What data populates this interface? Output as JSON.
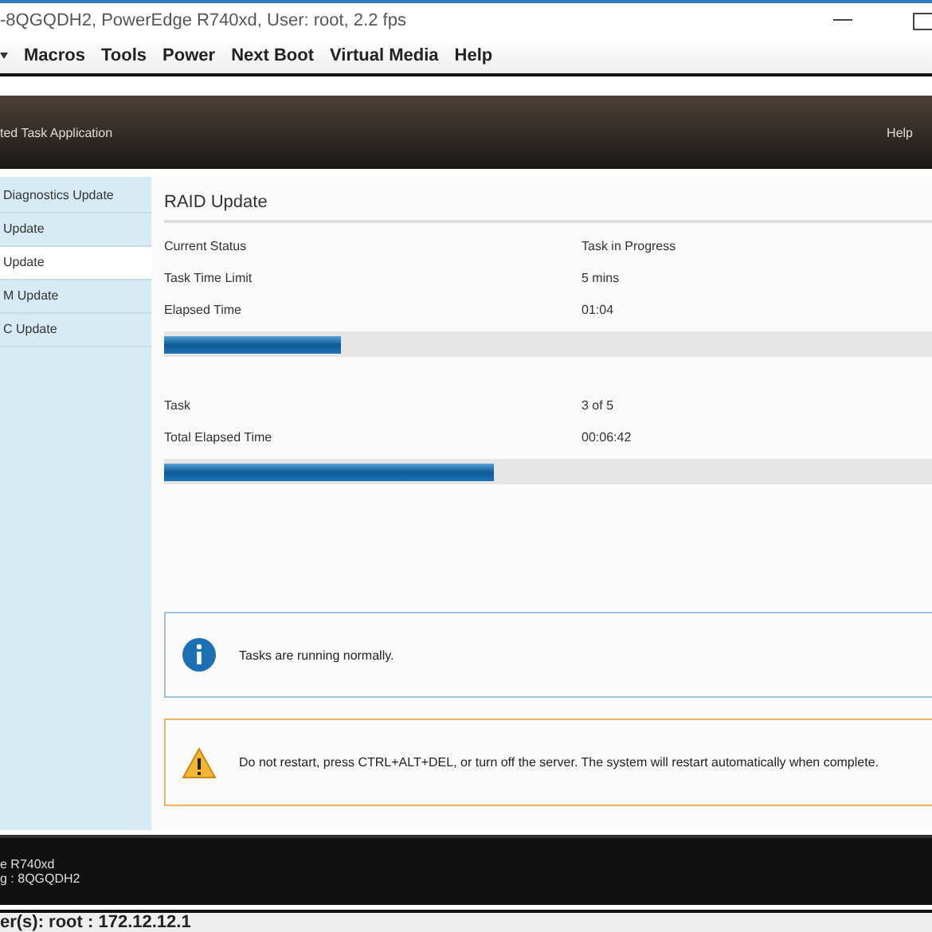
{
  "window": {
    "title": "-8QGQDH2, PowerEdge R740xd, User: root, 2.2 fps"
  },
  "menu": [
    "Macros",
    "Tools",
    "Power",
    "Next Boot",
    "Virtual Media",
    "Help"
  ],
  "header": {
    "title": "ted Task Application",
    "help": "Help"
  },
  "sidebar": {
    "items": [
      {
        "label": "Diagnostics Update",
        "selected": false
      },
      {
        "label": "Update",
        "selected": false
      },
      {
        "label": "Update",
        "selected": true
      },
      {
        "label": "M Update",
        "selected": false
      },
      {
        "label": "C Update",
        "selected": false
      }
    ]
  },
  "panel": {
    "title": "RAID Update",
    "rows": [
      {
        "label": "Current Status",
        "value": "Task in Progress"
      },
      {
        "label": "Task Time Limit",
        "value": "5 mins"
      },
      {
        "label": "Elapsed Time",
        "value": "01:04"
      }
    ],
    "progress": {
      "level": 0.23
    },
    "rows2": [
      {
        "label": "Task",
        "value": "3 of 5"
      },
      {
        "label": "Total Elapsed Time",
        "value": "00:06:42"
      }
    ],
    "progress2": {
      "level": 0.43
    },
    "messages": [
      {
        "kind": "info",
        "text": "Tasks are running normally."
      },
      {
        "kind": "warning",
        "text": "Do not restart, press CTRL+ALT+DEL, or turn off the server.  The system will restart automatically when complete."
      }
    ]
  },
  "footer": [
    "e R740xd",
    "g : 8QGQDH2"
  ],
  "status_bar": "er(s): root : 172.12.12.1"
}
